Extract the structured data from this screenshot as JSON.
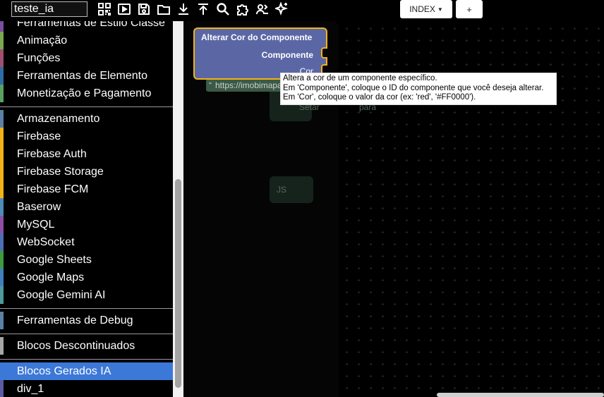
{
  "project": {
    "name": "teste_ia"
  },
  "toolbar": {
    "icons": [
      "qr-code-icon",
      "play-icon",
      "save-icon",
      "folder-icon",
      "download-icon",
      "upload-icon",
      "search-icon",
      "puzzle-icon",
      "users-icon",
      "sparkle-icon"
    ],
    "index_label": "INDEX",
    "plus_label": "+"
  },
  "sidebar": {
    "categories": [
      {
        "label": "Ferramentas de Estilo Classe",
        "color": "#7a4ea0"
      },
      {
        "label": "Animação",
        "color": "#7aa650"
      },
      {
        "label": "Funções",
        "color": "#a04e72"
      },
      {
        "label": "Ferramentas de Elemento",
        "color": "#2e6da4"
      },
      {
        "label": "Monetização e Pagamento",
        "color": "#5aa060"
      },
      {
        "label": "Armazenamento",
        "color": "#5b80a5"
      },
      {
        "label": "Firebase",
        "color": "#f2b318"
      },
      {
        "label": "Firebase Auth",
        "color": "#f2b318"
      },
      {
        "label": "Firebase Storage",
        "color": "#f2b318"
      },
      {
        "label": "Firebase FCM",
        "color": "#f2b318"
      },
      {
        "label": "Baserow",
        "color": "#4d8bb8"
      },
      {
        "label": "MySQL",
        "color": "#8e4fa3"
      },
      {
        "label": "WebSocket",
        "color": "#4c6fb5"
      },
      {
        "label": "Google Sheets",
        "color": "#3e9a3e"
      },
      {
        "label": "Google Maps",
        "color": "#3f7fbf"
      },
      {
        "label": "Google Gemini AI",
        "color": "#4c9a9a"
      },
      {
        "label": "Ferramentas de Debug",
        "color": "#5b80a5"
      },
      {
        "label": "Blocos Descontinuados",
        "color": "#a6a6a6"
      },
      {
        "label": "Blocos Gerados IA",
        "color": "#3c78d8"
      },
      {
        "label": "div_1",
        "color": "#5b5ba5"
      }
    ]
  },
  "workspace": {
    "block": {
      "title": "Alterar Cor do Componente",
      "input1": "Componente",
      "input2": "Cor",
      "color": "#5b67a5",
      "highlight": "#f2b318"
    },
    "background_block": {
      "text1": "Setar",
      "text2": "para",
      "url": "https://imobimapa.com.br",
      "js_label": "JS"
    },
    "tooltip": {
      "line1": "Altera a cor de um componente específico.",
      "line2": "Em 'Componente', coloque o ID do componente que você deseja alterar.",
      "line3": "Em 'Cor', coloque o valor da cor (ex: 'red', '#FF0000')."
    }
  }
}
